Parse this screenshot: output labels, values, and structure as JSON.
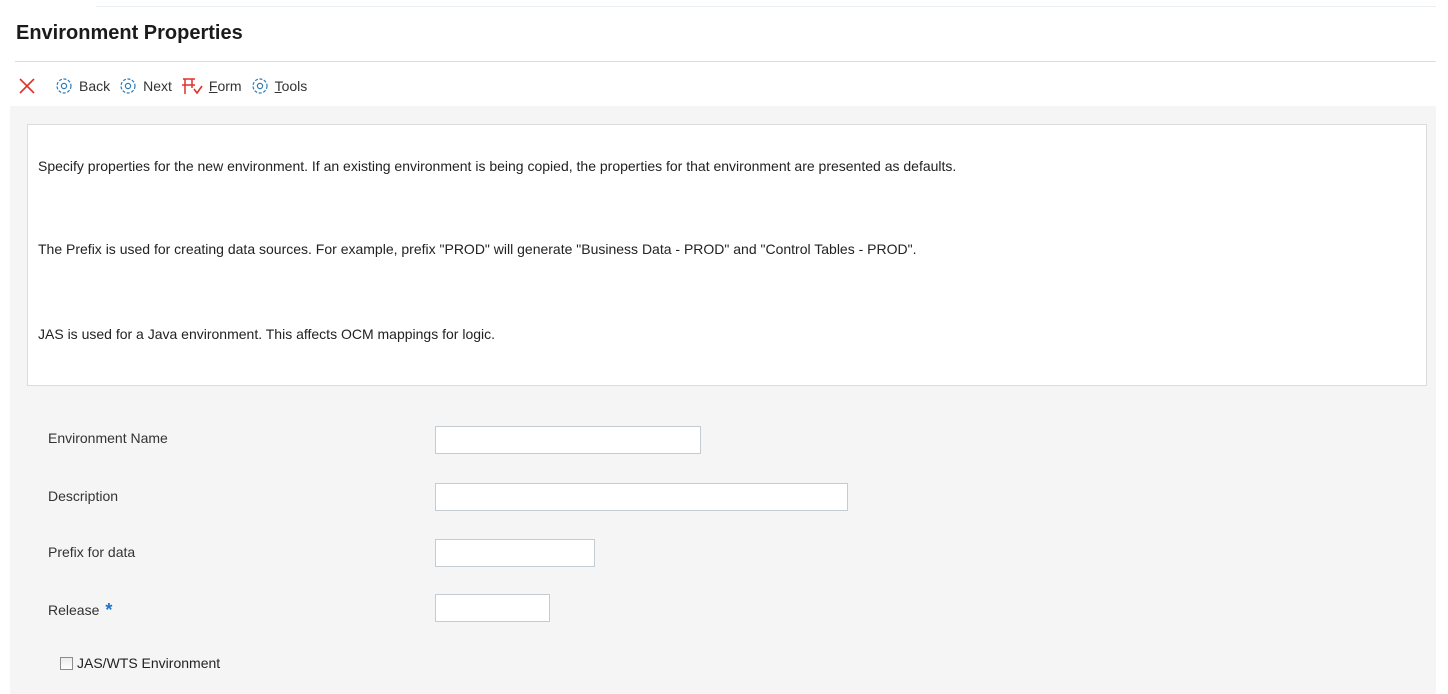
{
  "page": {
    "title": "Environment Properties"
  },
  "toolbar": {
    "close_icon": "close-x-icon",
    "back_label": "Back",
    "next_label": "Next",
    "form_label_mnemonic": "F",
    "form_label_rest": "orm",
    "tools_label_mnemonic": "T",
    "tools_label_rest": "ools",
    "accent_red": "#e0312b",
    "accent_blue": "#2a7ab8"
  },
  "info": {
    "line1": "Specify properties for the new environment. If an existing environment is being copied, the properties for that environment are presented as defaults.",
    "line2": "The Prefix is used for creating data sources. For example, prefix \"PROD\" will generate \"Business Data - PROD\" and \"Control Tables - PROD\".",
    "line3": "JAS is used for a Java environment. This affects OCM mappings for logic."
  },
  "fields": {
    "environment_name": {
      "label": "Environment Name",
      "value": ""
    },
    "description": {
      "label": "Description",
      "value": ""
    },
    "prefix": {
      "label": "Prefix for data",
      "value": ""
    },
    "release": {
      "label": "Release",
      "required_marker": "*",
      "value": ""
    }
  },
  "checkbox": {
    "label": "JAS/WTS Environment",
    "checked": false
  }
}
